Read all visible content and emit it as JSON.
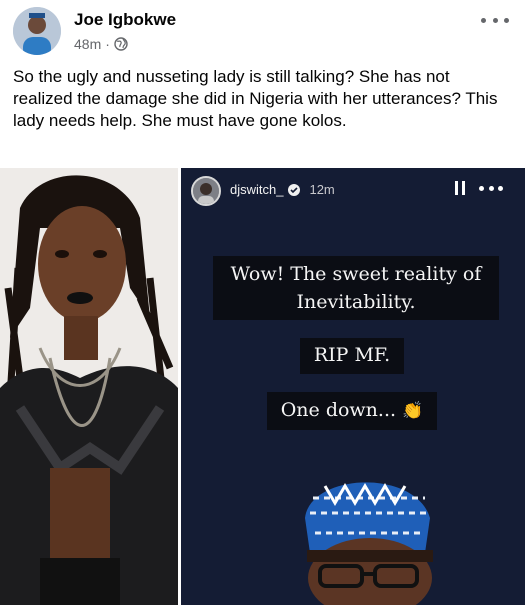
{
  "post": {
    "author": "Joe Igbokwe",
    "time": "48m",
    "separator": "·",
    "privacy_icon": "globe-icon",
    "more_icon": "more-dots-icon",
    "text": "So the ugly and nusseting lady is still talking? She has not realized the damage she did in Nigeria with her utterances? This lady needs help. She must have gone kolos."
  },
  "story": {
    "username": "djswitch_",
    "time": "12m",
    "verified_icon": "verified-badge-icon",
    "pause_icon": "pause-icon",
    "more_icon": "more-dots-icon",
    "caption_line1": "Wow! The sweet reality of Inevitability.",
    "caption_line2": "RIP MF.",
    "caption_line3": "One down...",
    "caption_emoji": "👏"
  },
  "colors": {
    "name": "#050505",
    "meta": "#65676b",
    "story_bg": "#141c34",
    "caption_bg": "#0b0d14"
  }
}
